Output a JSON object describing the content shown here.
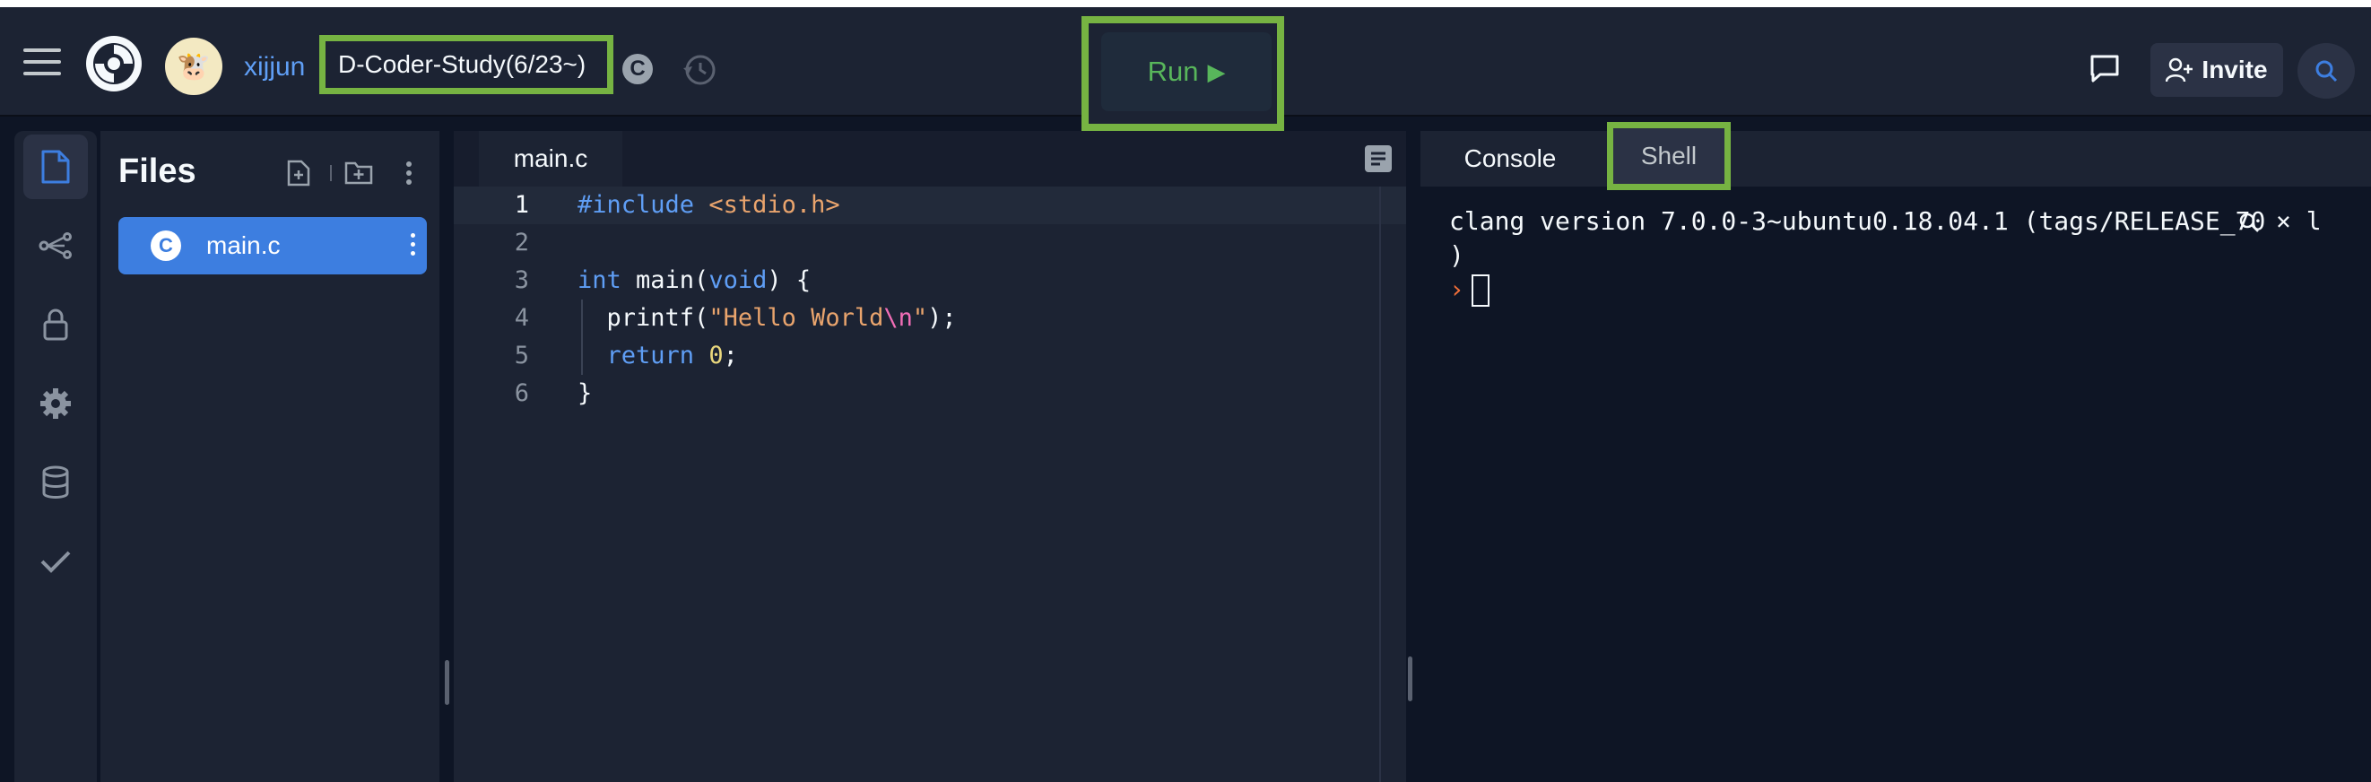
{
  "header": {
    "username": "xijjun",
    "repl_name": "D-Coder-Study(6/23~)",
    "language_badge": "C",
    "run_label": "Run",
    "run_icon": "▶",
    "invite_label": "Invite"
  },
  "files": {
    "title": "Files",
    "items": [
      {
        "name": "main.c",
        "icon": "C"
      }
    ]
  },
  "editor": {
    "tab": "main.c",
    "lines": [
      "1",
      "2",
      "3",
      "4",
      "5",
      "6"
    ]
  },
  "console": {
    "tabs": [
      "Console",
      "Shell"
    ],
    "output_line1": "clang version 7.0.0-3~ubuntu0.18.04.1 (tags/RELEASE_70",
    "output_line2": ")",
    "prompt": "›",
    "close_glyph": "×",
    "trailing": "l"
  },
  "colors": {
    "highlight": "#76b342",
    "accent_blue": "#3d7ee0",
    "run_green": "#58b65b"
  }
}
